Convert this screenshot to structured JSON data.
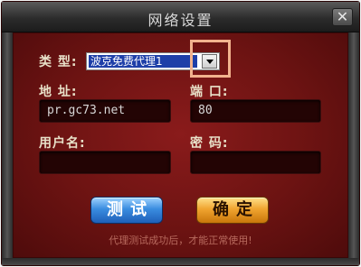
{
  "dialog": {
    "title": "网络设置",
    "close_glyph": "✕"
  },
  "form": {
    "type_label": "类 型:",
    "type_value": "波克免费代理1",
    "address_label": "地 址:",
    "address_value": "pr.gc73.net",
    "port_label": "端 口:",
    "port_value": "80",
    "username_label": "用户名:",
    "username_value": "",
    "password_label": "密 码:",
    "password_value": ""
  },
  "buttons": {
    "test_label": "测试",
    "ok_label": "确定"
  },
  "hint": "代理测试成功后，才能正常使用!",
  "colors": {
    "panel": "#6c1312",
    "test_button": "#3a8de0",
    "ok_button": "#f0a530",
    "highlight": "#f2b38e"
  }
}
